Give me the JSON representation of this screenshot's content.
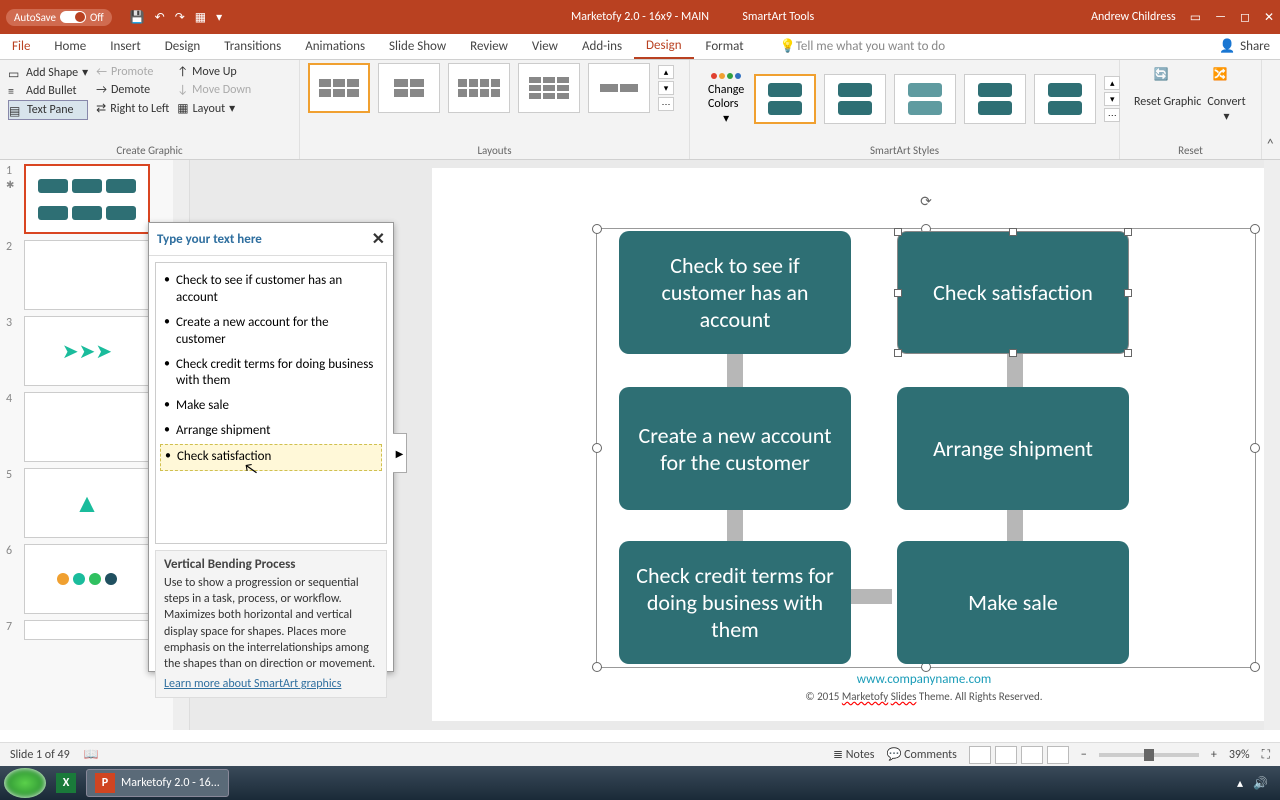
{
  "titlebar": {
    "autosave": "AutoSave",
    "autosave_state": "Off",
    "title": "Marketofy 2.0 - 16x9 - MAIN",
    "context_tab": "SmartArt Tools",
    "user": "Andrew Childress"
  },
  "menu": {
    "file": "File",
    "home": "Home",
    "insert": "Insert",
    "design": "Design",
    "transitions": "Transitions",
    "animations": "Animations",
    "slideshow": "Slide Show",
    "review": "Review",
    "view": "View",
    "addins": "Add-ins",
    "sa_design": "Design",
    "format": "Format",
    "tell": "Tell me what you want to do",
    "share": "Share"
  },
  "ribbon": {
    "add_shape": "Add Shape",
    "add_bullet": "Add Bullet",
    "text_pane": "Text Pane",
    "promote": "Promote",
    "demote": "Demote",
    "rtl": "Right to Left",
    "move_up": "Move Up",
    "move_down": "Move Down",
    "layout": "Layout",
    "create_graphic": "Create Graphic",
    "layouts": "Layouts",
    "change_colors": "Change Colors",
    "smartart_styles": "SmartArt Styles",
    "reset_graphic": "Reset Graphic",
    "convert": "Convert",
    "reset": "Reset"
  },
  "textpane": {
    "header": "Type your text here",
    "items": [
      "Check to see if customer has an account",
      "Create a new account for the customer",
      "Check credit terms for doing business with them",
      "Make sale",
      "Arrange shipment",
      "Check satisfaction"
    ],
    "selected_index": 5,
    "desc_title": "Vertical Bending Process",
    "desc_body": "Use to show a progression or sequential steps in a task, process, or workflow. Maximizes both horizontal and vertical display space for shapes. Places more emphasis on the interrelationships among the shapes than on direction or movement.",
    "learn": "Learn more about SmartArt graphics"
  },
  "shapes": {
    "s1": "Check to see if customer has an account",
    "s2": "Check satisfaction",
    "s3": "Create a new account for the customer",
    "s4": "Arrange shipment",
    "s5": "Check credit terms for doing business with them",
    "s6": "Make sale"
  },
  "slide": {
    "badge": "1",
    "link": "www.companyname.com",
    "copyright": "© 2015 Marketofy Slides Theme. All Rights Reserved."
  },
  "status": {
    "slide": "Slide 1 of 49",
    "notes": "Notes",
    "comments": "Comments",
    "zoom": "39%"
  },
  "taskbar": {
    "app": "Marketofy 2.0 - 16..."
  }
}
